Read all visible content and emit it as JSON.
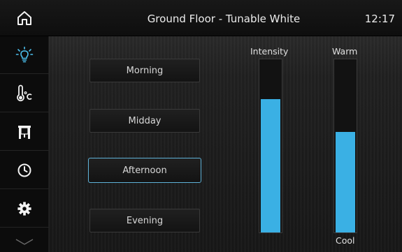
{
  "header": {
    "title": "Ground Floor - Tunable White",
    "time": "12:17",
    "home_icon": "home-icon"
  },
  "sidebar": {
    "items": [
      {
        "icon": "lightbulb-icon",
        "active": true
      },
      {
        "icon": "thermometer-celsius-icon",
        "active": false
      },
      {
        "icon": "blinds-icon",
        "active": false
      },
      {
        "icon": "clock-icon",
        "active": false
      },
      {
        "icon": "gear-icon",
        "active": false
      },
      {
        "icon": "chevron-down-icon",
        "active": false
      }
    ]
  },
  "scenes": [
    {
      "label": "Morning",
      "selected": false
    },
    {
      "label": "Midday",
      "selected": false
    },
    {
      "label": "Afternoon",
      "selected": true
    },
    {
      "label": "Evening",
      "selected": false
    }
  ],
  "sliders": {
    "intensity": {
      "label": "Intensity",
      "level_percent": 77
    },
    "warmth": {
      "top_label": "Warm",
      "bottom_label": "Cool",
      "level_percent": 58
    }
  },
  "colors": {
    "accent": "#3ab0e4",
    "selected_border": "#5fb2d8",
    "active_icon": "#4cc0ee",
    "icon": "#f2f2f2"
  }
}
